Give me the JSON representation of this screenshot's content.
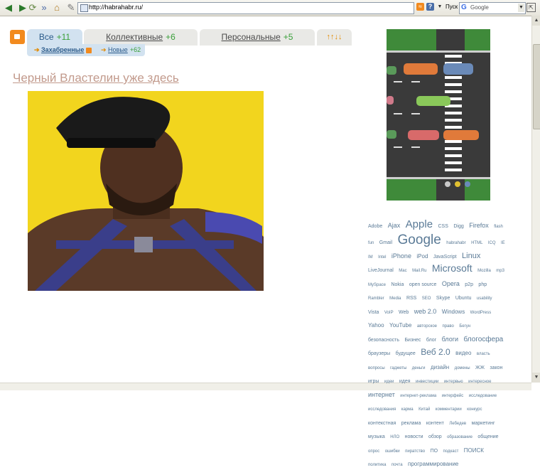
{
  "browser": {
    "address": "http://habrahabr.ru/",
    "go_label": "Пуск",
    "search_placeholder": "Google",
    "search_icon": "G"
  },
  "icons": {
    "back": "back-arrow-icon",
    "forward": "forward-arrow-icon",
    "home": "home-icon",
    "rss": "rss-feed-icon",
    "help": "help-icon",
    "search": "google-search-icon"
  },
  "tabs": [
    {
      "label": "Все",
      "count": "+11"
    },
    {
      "label": "Коллективные",
      "count": "+6"
    },
    {
      "label": "Персональные",
      "count": "+5"
    }
  ],
  "sort_glyph": "↑↑↓↓",
  "subtabs": {
    "captured": "Захабренные",
    "new_label": "Новые",
    "new_count": "+62"
  },
  "post": {
    "title": "Черный Властелин уже здесь"
  },
  "colors": {
    "accent_orange": "#f28a1e",
    "tab_active": "#d2e2f0",
    "count_green": "#3aa03a",
    "link_blue": "#2a5a8a",
    "title_color": "#c29a8c",
    "tag_color": "#5a7a96"
  },
  "tags": [
    {
      "t": "Adobe",
      "s": 7
    },
    {
      "t": "Ajax",
      "s": 9
    },
    {
      "t": "Apple",
      "s": 15
    },
    {
      "t": "CSS",
      "s": 7
    },
    {
      "t": "Digg",
      "s": 7
    },
    {
      "t": "Firefox",
      "s": 9
    },
    {
      "t": "flash",
      "s": 6
    },
    {
      "t": "fun",
      "s": 6
    },
    {
      "t": "Gmail",
      "s": 7
    },
    {
      "t": "Google",
      "s": 19
    },
    {
      "t": "habrahabr",
      "s": 6
    },
    {
      "t": "HTML",
      "s": 6
    },
    {
      "t": "ICQ",
      "s": 6
    },
    {
      "t": "IE",
      "s": 6
    },
    {
      "t": "IM",
      "s": 6
    },
    {
      "t": "Intel",
      "s": 6
    },
    {
      "t": "iPhone",
      "s": 9
    },
    {
      "t": "iPod",
      "s": 8
    },
    {
      "t": "JavaScript",
      "s": 7
    },
    {
      "t": "Linux",
      "s": 11
    },
    {
      "t": "LiveJournal",
      "s": 7
    },
    {
      "t": "Mac",
      "s": 6
    },
    {
      "t": "Mail.Ru",
      "s": 6
    },
    {
      "t": "Microsoft",
      "s": 14
    },
    {
      "t": "Mozilla",
      "s": 6
    },
    {
      "t": "mp3",
      "s": 6
    },
    {
      "t": "MySpace",
      "s": 6
    },
    {
      "t": "Nokia",
      "s": 7
    },
    {
      "t": "open source",
      "s": 7
    },
    {
      "t": "Opera",
      "s": 9
    },
    {
      "t": "p2p",
      "s": 7
    },
    {
      "t": "php",
      "s": 7
    },
    {
      "t": "Rambler",
      "s": 6
    },
    {
      "t": "Media",
      "s": 6
    },
    {
      "t": "RSS",
      "s": 7
    },
    {
      "t": "SEO",
      "s": 6
    },
    {
      "t": "Skype",
      "s": 7
    },
    {
      "t": "Ubuntu",
      "s": 7
    },
    {
      "t": "usability",
      "s": 6
    },
    {
      "t": "Vista",
      "s": 7
    },
    {
      "t": "VoIP",
      "s": 6
    },
    {
      "t": "Web",
      "s": 7
    },
    {
      "t": "web 2.0",
      "s": 9
    },
    {
      "t": "Windows",
      "s": 8
    },
    {
      "t": "WordPress",
      "s": 6
    },
    {
      "t": "Yahoo",
      "s": 8
    },
    {
      "t": "YouTube",
      "s": 8
    },
    {
      "t": "авторское",
      "s": 6
    },
    {
      "t": "право",
      "s": 6
    },
    {
      "t": "Бегун",
      "s": 6
    },
    {
      "t": "безопасность",
      "s": 7
    },
    {
      "t": "Бизнес",
      "s": 7
    },
    {
      "t": "блог",
      "s": 7
    },
    {
      "t": "блоги",
      "s": 9
    },
    {
      "t": "блогосфера",
      "s": 10
    },
    {
      "t": "браузеры",
      "s": 7
    },
    {
      "t": "будущее",
      "s": 7
    },
    {
      "t": "Веб 2.0",
      "s": 12
    },
    {
      "t": "видео",
      "s": 8
    },
    {
      "t": "власть",
      "s": 6
    },
    {
      "t": "вопросы",
      "s": 6
    },
    {
      "t": "гаджеты",
      "s": 6
    },
    {
      "t": "деньги",
      "s": 6
    },
    {
      "t": "дизайн",
      "s": 8
    },
    {
      "t": "домены",
      "s": 6
    },
    {
      "t": "ЖЖ",
      "s": 7
    },
    {
      "t": "закон",
      "s": 7
    },
    {
      "t": "игры",
      "s": 7
    },
    {
      "t": "идеи",
      "s": 6
    },
    {
      "t": "идея",
      "s": 7
    },
    {
      "t": "инвестиции",
      "s": 6
    },
    {
      "t": "интервью",
      "s": 6
    },
    {
      "t": "интересное",
      "s": 6
    },
    {
      "t": "интернет",
      "s": 9
    },
    {
      "t": "интернет-реклама",
      "s": 6
    },
    {
      "t": "интерфейс",
      "s": 6
    },
    {
      "t": "исследование",
      "s": 6
    },
    {
      "t": "исследования",
      "s": 6
    },
    {
      "t": "карма",
      "s": 6
    },
    {
      "t": "Китай",
      "s": 6
    },
    {
      "t": "комментарии",
      "s": 6
    },
    {
      "t": "конкурс",
      "s": 6
    },
    {
      "t": "контекстная",
      "s": 7
    },
    {
      "t": "реклама",
      "s": 7
    },
    {
      "t": "контент",
      "s": 7
    },
    {
      "t": "Лебедев",
      "s": 6
    },
    {
      "t": "маркетинг",
      "s": 7
    },
    {
      "t": "музыка",
      "s": 7
    },
    {
      "t": "НЛО",
      "s": 6
    },
    {
      "t": "новости",
      "s": 7
    },
    {
      "t": "обзор",
      "s": 7
    },
    {
      "t": "образование",
      "s": 6
    },
    {
      "t": "общение",
      "s": 7
    },
    {
      "t": "опрос",
      "s": 6
    },
    {
      "t": "ошибки",
      "s": 6
    },
    {
      "t": "пиратство",
      "s": 6
    },
    {
      "t": "ПО",
      "s": 7
    },
    {
      "t": "подкаст",
      "s": 6
    },
    {
      "t": "ПОИСК",
      "s": 8
    },
    {
      "t": "политика",
      "s": 6
    },
    {
      "t": "почта",
      "s": 6
    },
    {
      "t": "программирование",
      "s": 8
    }
  ]
}
